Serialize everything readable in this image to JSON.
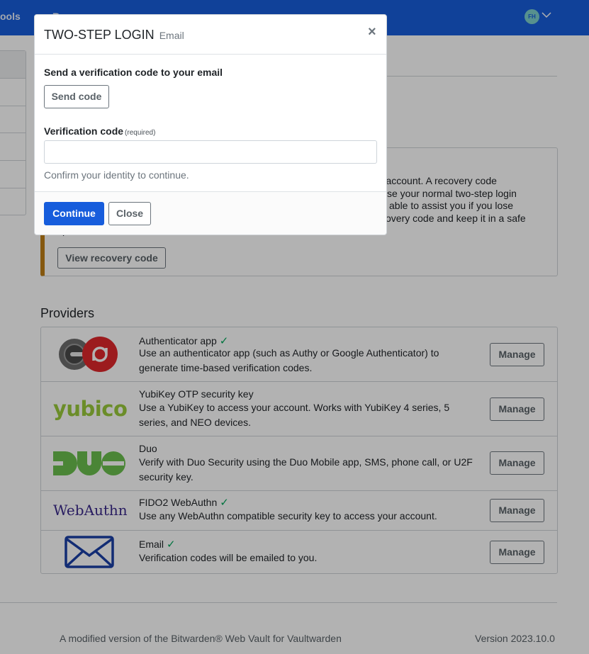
{
  "navbar": {
    "partial_tools": "ools",
    "partial_second": "R",
    "avatar_initials": "FH",
    "color": "#175ddc"
  },
  "recovery_callout": {
    "visible_text_lines": [
      "en account. A recovery code",
      "se your normal two-step login",
      "able to assist you if you lose",
      "covery code and keep it in a safe",
      "p"
    ],
    "button_label": "View recovery code",
    "accent_color": "#bf7e16"
  },
  "providers": {
    "title": "Providers",
    "manage_label": "Manage",
    "items": [
      {
        "name": "Authenticator app",
        "enabled": true,
        "description": "Use an authenticator app (such as Authy or Google Authenticator) to generate time-based verification codes.",
        "icon": "authenticator-logo"
      },
      {
        "name": "YubiKey OTP security key",
        "enabled": false,
        "description": "Use a YubiKey to access your account. Works with YubiKey 4 series, 5 series, and NEO devices.",
        "icon": "yubico-logo",
        "logo_text": "yubico"
      },
      {
        "name": "Duo",
        "enabled": false,
        "description": "Verify with Duo Security using the Duo Mobile app, SMS, phone call, or U2F security key.",
        "icon": "duo-logo",
        "logo_text": "DUO"
      },
      {
        "name": "FIDO2 WebAuthn",
        "enabled": true,
        "description": "Use any WebAuthn compatible security key to access your account.",
        "icon": "webauthn-logo",
        "logo_text": "WebAuthn"
      },
      {
        "name": "Email",
        "enabled": true,
        "description": "Verification codes will be emailed to you.",
        "icon": "envelope-icon"
      }
    ]
  },
  "footer": {
    "left": "A modified version of the Bitwarden® Web Vault for Vaultwarden",
    "right": "Version 2023.10.0"
  },
  "modal": {
    "title": "TWO-STEP LOGIN",
    "subtitle": "Email",
    "close_symbol": "×",
    "send_label": "Send a verification code to your email",
    "send_button": "Send code",
    "code_label": "Verification code",
    "required_note": "(required)",
    "code_value": "",
    "help_text": "Confirm your identity to continue.",
    "continue_button": "Continue",
    "close_button": "Close"
  },
  "colors": {
    "primary": "#175ddc",
    "success_check": "#00a65a",
    "yubico_green": "#9aca3c",
    "duo_green": "#6bbf4e",
    "webauthn_purple": "#3b2a8c",
    "envelope_blue": "#1a3fa6"
  }
}
